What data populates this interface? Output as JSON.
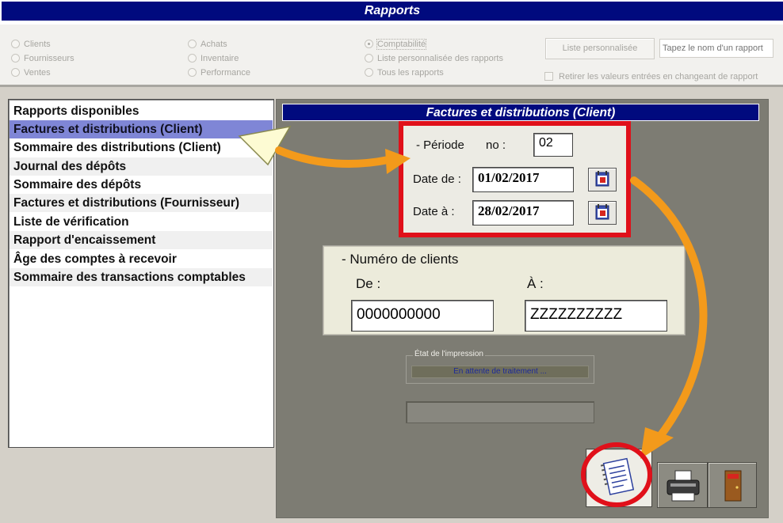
{
  "window": {
    "title": "Rapports"
  },
  "filters": {
    "radios": [
      {
        "label": "Clients",
        "checked": false
      },
      {
        "label": "Fournisseurs",
        "checked": false
      },
      {
        "label": "Ventes",
        "checked": false
      },
      {
        "label": "Achats",
        "checked": false
      },
      {
        "label": "Inventaire",
        "checked": false
      },
      {
        "label": "Performance",
        "checked": false
      },
      {
        "label": "Comptabilité",
        "checked": true
      },
      {
        "label": "Liste personnalisée des rapports",
        "checked": false
      },
      {
        "label": "Tous les rapports",
        "checked": false
      }
    ],
    "custom_list_button": "Liste personnalisée",
    "report_name_placeholder": "Tapez le nom d'un rapport",
    "reset_checkbox_label": "Retirer les valeurs entrées en changeant de rapport"
  },
  "reports_list": {
    "items": [
      "Rapports disponibles",
      "Factures et distributions (Client)",
      "Sommaire des distributions (Client)",
      "Journal des dépôts",
      "Sommaire des dépôts",
      "Factures et distributions (Fournisseur)",
      "Liste de vérification",
      "Rapport d'encaissement",
      "Âge des comptes à recevoir",
      "Sommaire des transactions comptables"
    ],
    "selected_index": 1
  },
  "report_panel": {
    "title": "Factures et distributions (Client)",
    "period": {
      "label": "- Période",
      "no_label": "no :",
      "no_value": "02",
      "date_from_label": "Date de :",
      "date_from_value": "01/02/2017",
      "date_to_label": "Date à :",
      "date_to_value": "28/02/2017"
    },
    "client_numbers": {
      "label": "- Numéro de clients",
      "from_label": "De :",
      "from_value": "0000000000",
      "to_label": "À :",
      "to_value": "ZZZZZZZZZZ"
    },
    "print_status": {
      "legend": "État de l'impression",
      "status": "En attente de traitement ..."
    }
  },
  "colors": {
    "title_bar": "#000a7e",
    "highlight_box": "#e0101a",
    "annotation_arrow": "#f39a1b",
    "selection": "#7f86d6"
  }
}
